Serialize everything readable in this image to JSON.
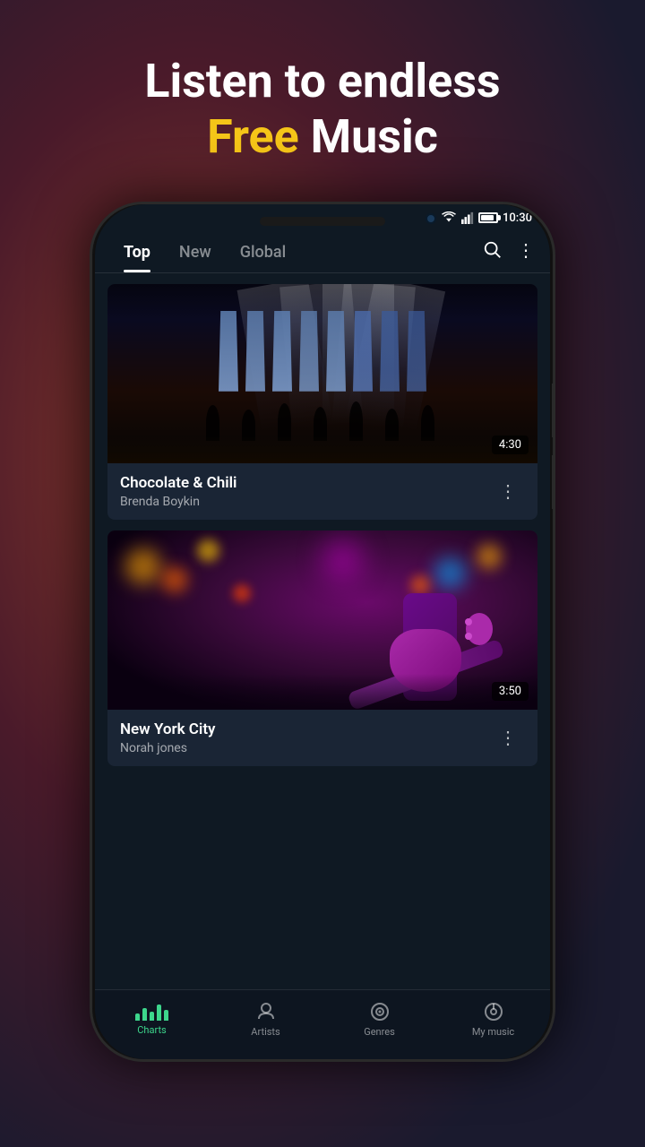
{
  "hero": {
    "line1": "Listen to endless",
    "free_word": "Free",
    "line2": "Music"
  },
  "status_bar": {
    "time": "10:30"
  },
  "tabs": [
    {
      "id": "top",
      "label": "Top",
      "active": true
    },
    {
      "id": "new",
      "label": "New",
      "active": false
    },
    {
      "id": "global",
      "label": "Global",
      "active": false
    }
  ],
  "songs": [
    {
      "title": "Chocolate & Chili",
      "artist": "Brenda Boykin",
      "duration": "4:30"
    },
    {
      "title": "New York City",
      "artist": "Norah jones",
      "duration": "3:50"
    }
  ],
  "bottom_nav": [
    {
      "id": "charts",
      "label": "Charts",
      "active": true,
      "icon": "charts-icon"
    },
    {
      "id": "artists",
      "label": "Artists",
      "active": false,
      "icon": "artists-icon"
    },
    {
      "id": "genres",
      "label": "Genres",
      "active": false,
      "icon": "genres-icon"
    },
    {
      "id": "my_music",
      "label": "My music",
      "active": false,
      "icon": "mymusic-icon"
    }
  ]
}
